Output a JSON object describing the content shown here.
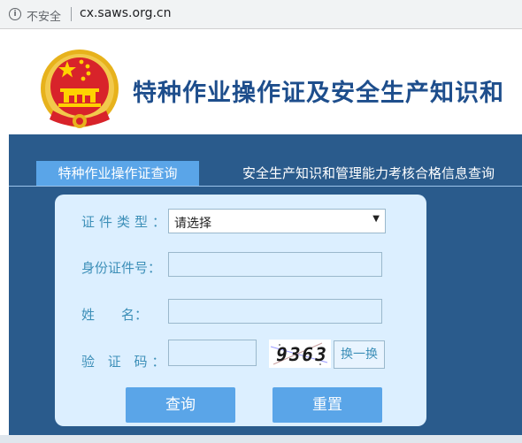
{
  "browser": {
    "security_label": "不安全",
    "url": "cx.saws.org.cn"
  },
  "header": {
    "site_title": "特种作业操作证及安全生产知识和",
    "emblem_icon": "national-emblem-icon"
  },
  "tabs": [
    {
      "label": "特种作业操作证查询",
      "active": true
    },
    {
      "label": "安全生产知识和管理能力考核合格信息查询",
      "active": false
    }
  ],
  "form": {
    "cert_type": {
      "label": "证件类型：",
      "selected": "请选择"
    },
    "id_number": {
      "label": "身份证件号：",
      "value": ""
    },
    "name": {
      "label": "姓　　名：",
      "value": ""
    },
    "captcha": {
      "label": "验 证 码：",
      "value": "",
      "image_text": "9363",
      "refresh_label": "换一换"
    },
    "query_label": "查询",
    "reset_label": "重置"
  },
  "colors": {
    "brand_blue": "#2a5b8c",
    "tab_active": "#5aa5e8",
    "panel_bg": "#dcefff",
    "label_color": "#3d8fb8",
    "title_color": "#1e4e8c"
  }
}
